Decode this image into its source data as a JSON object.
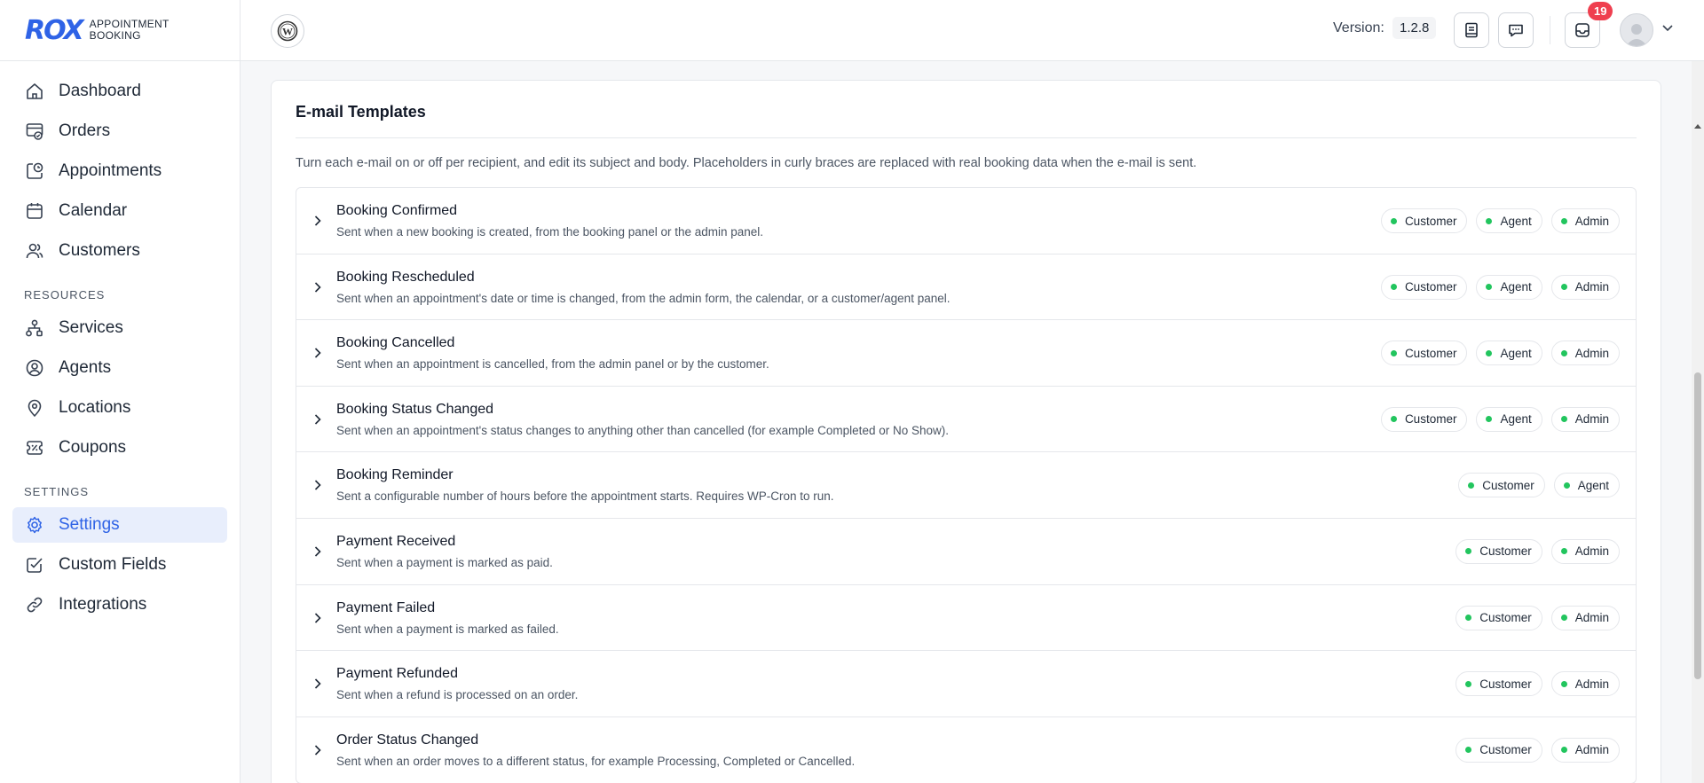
{
  "brand": {
    "logo_mark": "ROX",
    "line1": "APPOINTMENT",
    "line2": "BOOKING"
  },
  "sidebar": {
    "main": [
      {
        "label": "Dashboard",
        "icon": "home-icon"
      },
      {
        "label": "Orders",
        "icon": "orders-icon"
      },
      {
        "label": "Appointments",
        "icon": "appointments-icon"
      },
      {
        "label": "Calendar",
        "icon": "calendar-icon"
      },
      {
        "label": "Customers",
        "icon": "users-icon"
      }
    ],
    "resources_title": "RESOURCES",
    "resources": [
      {
        "label": "Services",
        "icon": "services-icon"
      },
      {
        "label": "Agents",
        "icon": "agent-icon"
      },
      {
        "label": "Locations",
        "icon": "location-pin-icon"
      },
      {
        "label": "Coupons",
        "icon": "coupon-icon"
      }
    ],
    "settings_title": "SETTINGS",
    "settings": [
      {
        "label": "Settings",
        "icon": "gear-icon",
        "active": true
      },
      {
        "label": "Custom Fields",
        "icon": "checkbox-icon"
      },
      {
        "label": "Integrations",
        "icon": "link-icon"
      }
    ]
  },
  "topbar": {
    "version_label": "Version:",
    "version_value": "1.2.8",
    "notifications_count": "19"
  },
  "email_templates": {
    "title": "E-mail Templates",
    "description": "Turn each e-mail on or off per recipient, and edit its subject and body. Placeholders in curly braces are replaced with real booking data when the e-mail is sent.",
    "items": [
      {
        "name": "Booking Confirmed",
        "desc": "Sent when a new booking is created, from the booking panel or the admin panel.",
        "recipients": [
          "Customer",
          "Agent",
          "Admin"
        ]
      },
      {
        "name": "Booking Rescheduled",
        "desc": "Sent when an appointment's date or time is changed, from the admin form, the calendar, or a customer/agent panel.",
        "recipients": [
          "Customer",
          "Agent",
          "Admin"
        ]
      },
      {
        "name": "Booking Cancelled",
        "desc": "Sent when an appointment is cancelled, from the admin panel or by the customer.",
        "recipients": [
          "Customer",
          "Agent",
          "Admin"
        ]
      },
      {
        "name": "Booking Status Changed",
        "desc": "Sent when an appointment's status changes to anything other than cancelled (for example Completed or No Show).",
        "recipients": [
          "Customer",
          "Agent",
          "Admin"
        ]
      },
      {
        "name": "Booking Reminder",
        "desc": "Sent a configurable number of hours before the appointment starts. Requires WP-Cron to run.",
        "recipients": [
          "Customer",
          "Agent"
        ]
      },
      {
        "name": "Payment Received",
        "desc": "Sent when a payment is marked as paid.",
        "recipients": [
          "Customer",
          "Admin"
        ]
      },
      {
        "name": "Payment Failed",
        "desc": "Sent when a payment is marked as failed.",
        "recipients": [
          "Customer",
          "Admin"
        ]
      },
      {
        "name": "Payment Refunded",
        "desc": "Sent when a refund is processed on an order.",
        "recipients": [
          "Customer",
          "Admin"
        ]
      },
      {
        "name": "Order Status Changed",
        "desc": "Sent when an order moves to a different status, for example Processing, Completed or Cancelled.",
        "recipients": [
          "Customer",
          "Admin"
        ]
      }
    ]
  },
  "colors": {
    "accent": "#2f63e6",
    "active_dot": "#22c55e",
    "badge": "#ef3f4f"
  }
}
